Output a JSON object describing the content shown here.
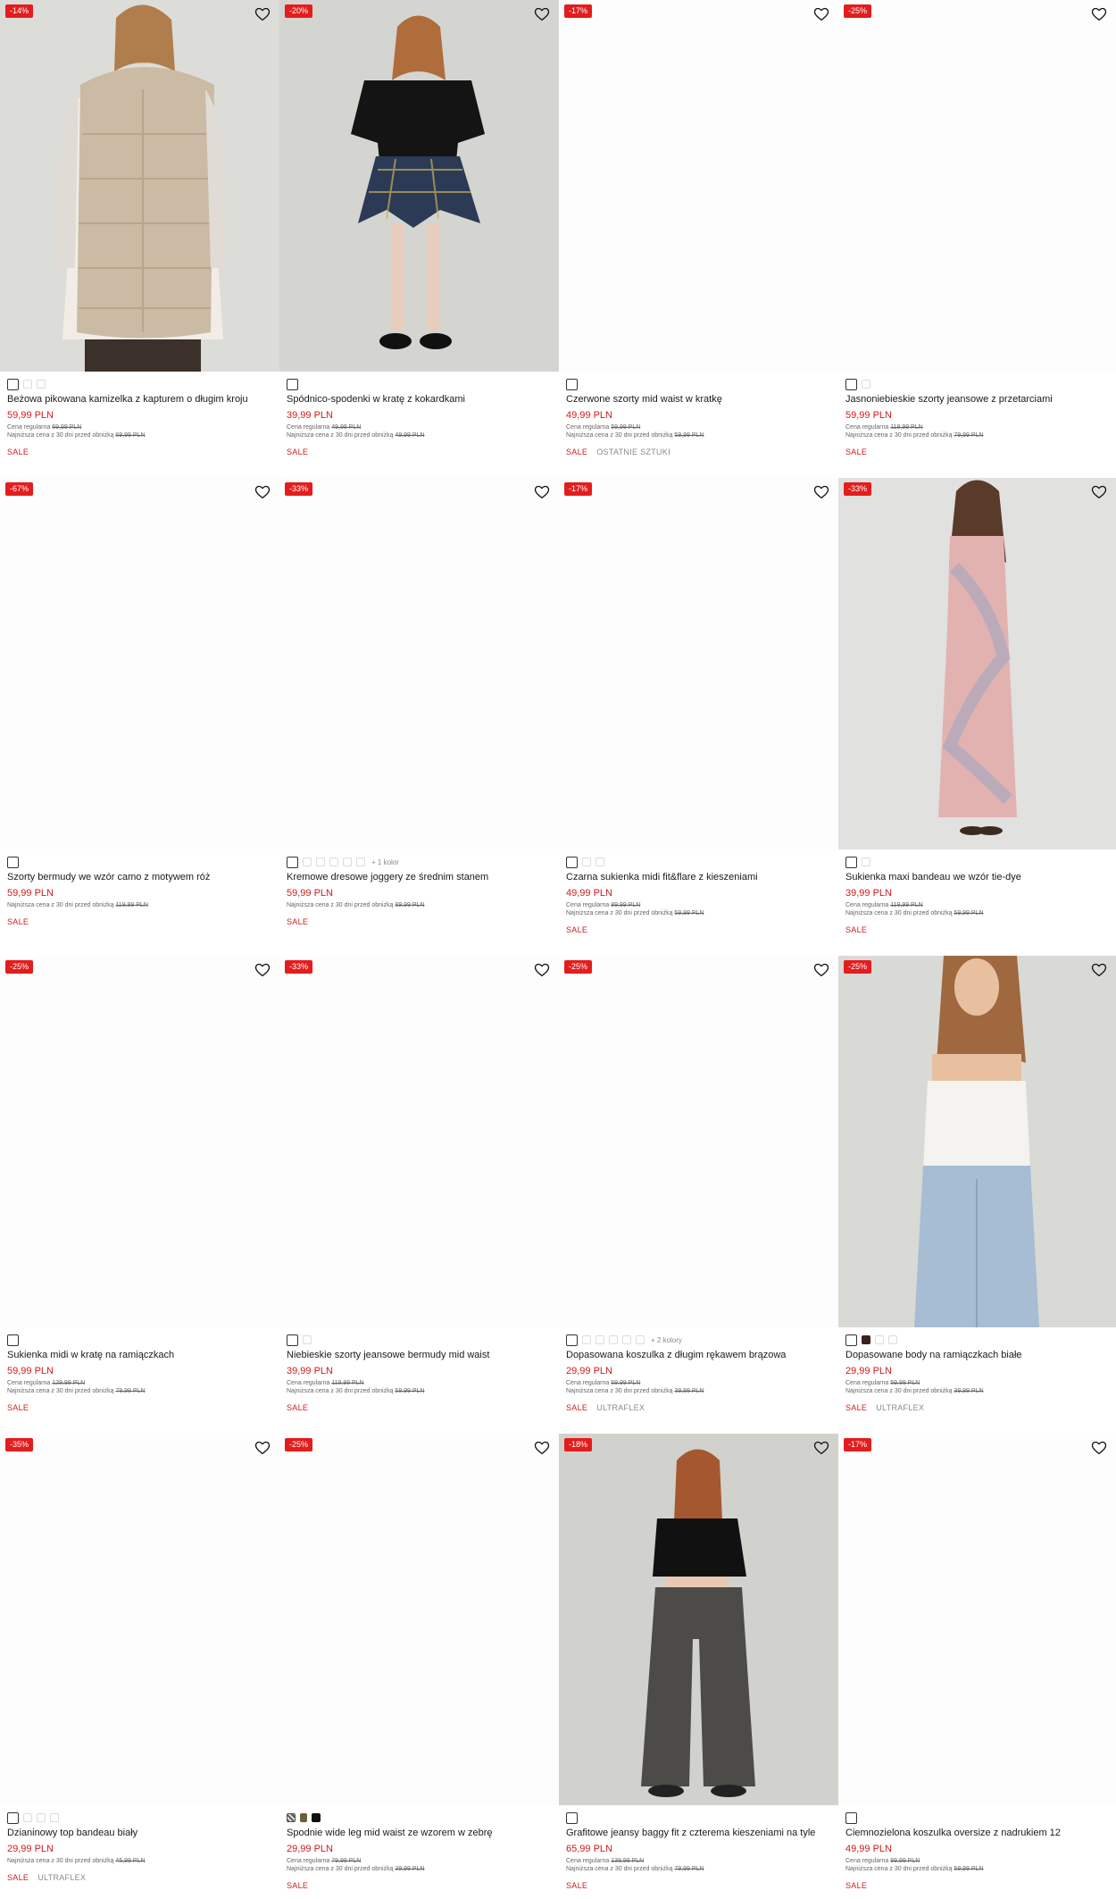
{
  "products": [
    {
      "discount": "-14%",
      "name": "Beżowa pikowana kamizelka z kapturem o długim kroju",
      "price": "59,99 PLN",
      "regular_label": "Cena regularna",
      "regular": "69,99 PLN",
      "lowest_label": "Najniższa cena z 30 dni przed obniżką",
      "lowest": "69,99 PLN",
      "tags": [
        "SALE"
      ],
      "swatches": [
        "selected",
        "light",
        "light"
      ],
      "photo": "beige-vest"
    },
    {
      "discount": "-20%",
      "name": "Spódnico-spodenki w kratę z kokardkami",
      "price": "39,99 PLN",
      "regular_label": "Cena regularna",
      "regular": "49,99 PLN",
      "lowest_label": "Najniższa cena z 30 dni przed obniżką",
      "lowest": "49,99 PLN",
      "tags": [
        "SALE"
      ],
      "swatches": [
        "selected"
      ],
      "photo": "plaid-skort"
    },
    {
      "discount": "-17%",
      "name": "Czerwone szorty mid waist w kratkę",
      "price": "49,99 PLN",
      "regular_label": "Cena regularna",
      "regular": "59,99 PLN",
      "lowest_label": "Najniższa cena z 30 dni przed obniżką",
      "lowest": "59,99 PLN",
      "tags": [
        "SALE",
        "OSTATNIE SZTUKI"
      ],
      "swatches": [
        "selected"
      ],
      "photo": ""
    },
    {
      "discount": "-25%",
      "name": "Jasnoniebieskie szorty jeansowe z przetarciami",
      "price": "59,99 PLN",
      "regular_label": "Cena regularna",
      "regular": "119,99 PLN",
      "lowest_label": "Najniższa cena z 30 dni przed obniżką",
      "lowest": "79,99 PLN",
      "tags": [
        "SALE"
      ],
      "swatches": [
        "selected",
        "light"
      ],
      "photo": ""
    },
    {
      "discount": "-67%",
      "name": "Szorty bermudy we wzór camo z motywem róż",
      "price": "59,99 PLN",
      "regular_label": "",
      "regular": "",
      "lowest_label": "Najniższa cena z 30 dni przed obniżką",
      "lowest": "119,99 PLN",
      "tags": [
        "SALE"
      ],
      "swatches": [
        "selected"
      ],
      "photo": ""
    },
    {
      "discount": "-33%",
      "name": "Kremowe dresowe joggery ze średnim stanem",
      "price": "59,99 PLN",
      "regular_label": "",
      "regular": "",
      "lowest_label": "Najniższa cena z 30 dni przed obniżką",
      "lowest": "89,99 PLN",
      "tags": [
        "SALE"
      ],
      "swatches": [
        "selected",
        "light",
        "light",
        "light",
        "light",
        "light"
      ],
      "more": "+ 1 kolor",
      "photo": ""
    },
    {
      "discount": "-17%",
      "name": "Czarna sukienka midi fit&flare z kieszeniami",
      "price": "49,99 PLN",
      "regular_label": "Cena regularna",
      "regular": "89,99 PLN",
      "lowest_label": "Najniższa cena z 30 dni przed obniżką",
      "lowest": "59,99 PLN",
      "tags": [
        "SALE"
      ],
      "swatches": [
        "selected",
        "light",
        "light"
      ],
      "photo": ""
    },
    {
      "discount": "-33%",
      "name": "Sukienka maxi bandeau we wzór tie-dye",
      "price": "39,99 PLN",
      "regular_label": "Cena regularna",
      "regular": "119,99 PLN",
      "lowest_label": "Najniższa cena z 30 dni przed obniżką",
      "lowest": "59,99 PLN",
      "tags": [
        "SALE"
      ],
      "swatches": [
        "selected",
        "light"
      ],
      "photo": "tiedye-dress"
    },
    {
      "discount": "-25%",
      "name": "Sukienka midi w kratę na ramiączkach",
      "price": "59,99 PLN",
      "regular_label": "Cena regularna",
      "regular": "129,99 PLN",
      "lowest_label": "Najniższa cena z 30 dni przed obniżką",
      "lowest": "79,99 PLN",
      "tags": [
        "SALE"
      ],
      "swatches": [
        "selected"
      ],
      "photo": ""
    },
    {
      "discount": "-33%",
      "name": "Niebieskie szorty jeansowe bermudy mid waist",
      "price": "39,99 PLN",
      "regular_label": "Cena regularna",
      "regular": "119,99 PLN",
      "lowest_label": "Najniższa cena z 30 dni przed obniżką",
      "lowest": "59,99 PLN",
      "tags": [
        "SALE"
      ],
      "swatches": [
        "selected",
        "light"
      ],
      "photo": ""
    },
    {
      "discount": "-25%",
      "name": "Dopasowana koszulka z długim rękawem brązowa",
      "price": "29,99 PLN",
      "regular_label": "Cena regularna",
      "regular": "59,99 PLN",
      "lowest_label": "Najniższa cena z 30 dni przed obniżką",
      "lowest": "39,99 PLN",
      "tags": [
        "SALE",
        "ULTRAFLEX"
      ],
      "swatches": [
        "selected",
        "light",
        "light",
        "light",
        "light",
        "light"
      ],
      "more": "+ 2 kolory",
      "photo": ""
    },
    {
      "discount": "-25%",
      "name": "Dopasowane body na ramiączkach białe",
      "price": "29,99 PLN",
      "regular_label": "Cena regularna",
      "regular": "59,99 PLN",
      "lowest_label": "Najniższa cena z 30 dni przed obniżką",
      "lowest": "39,99 PLN",
      "tags": [
        "SALE",
        "ULTRAFLEX"
      ],
      "swatches": [
        "selected",
        "dark",
        "light",
        "light"
      ],
      "photo": "white-body"
    },
    {
      "discount": "-35%",
      "name": "Dzianinowy top bandeau biały",
      "price": "29,99 PLN",
      "regular_label": "",
      "regular": "",
      "lowest_label": "Najniższa cena z 30 dni przed obniżką",
      "lowest": "45,99 PLN",
      "tags": [
        "SALE",
        "ULTRAFLEX"
      ],
      "swatches": [
        "selected",
        "light",
        "light",
        "light"
      ],
      "photo": ""
    },
    {
      "discount": "-25%",
      "name": "Spodnie wide leg mid waist ze wzorem w zebrę",
      "price": "29,99 PLN",
      "regular_label": "Cena regularna",
      "regular": "79,99 PLN",
      "lowest_label": "Najniższa cena z 30 dni przed obniżką",
      "lowest": "39,99 PLN",
      "tags": [
        "SALE"
      ],
      "swatches": [
        "zebra",
        "olive",
        "black"
      ],
      "photo": ""
    },
    {
      "discount": "-18%",
      "name": "Grafitowe jeansy baggy fit z czterema kieszeniami na tyle",
      "price": "65,99 PLN",
      "regular_label": "Cena regularna",
      "regular": "139,99 PLN",
      "lowest_label": "Najniższa cena z 30 dni przed obniżką",
      "lowest": "79,99 PLN",
      "tags": [
        "SALE"
      ],
      "swatches": [
        "selected"
      ],
      "photo": "gray-jeans"
    },
    {
      "discount": "-17%",
      "name": "Ciemnozielona koszulka oversize z nadrukiem 12",
      "price": "49,99 PLN",
      "regular_label": "Cena regularna",
      "regular": "89,99 PLN",
      "lowest_label": "Najniższa cena z 30 dni przed obniżką",
      "lowest": "59,99 PLN",
      "tags": [
        "SALE"
      ],
      "swatches": [
        "selected"
      ],
      "photo": ""
    }
  ],
  "colors": {
    "sale": "#d01c1c",
    "badge": "#e31d1d",
    "muted": "#8a8a8a"
  },
  "icons": {
    "favorite": "heart-outline-icon"
  }
}
